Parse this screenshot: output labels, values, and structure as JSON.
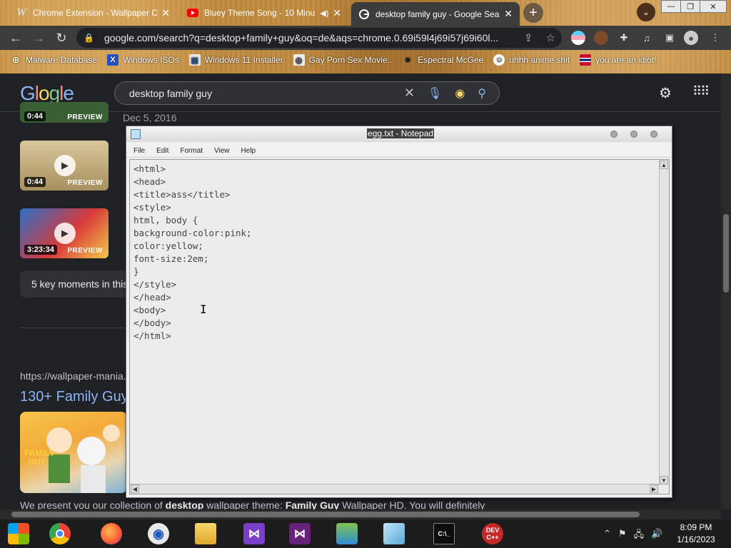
{
  "browser": {
    "tabs": [
      {
        "label": "Chrome Extension - Wallpaper Cr",
        "icon": "wallpaper-favicon",
        "active": false
      },
      {
        "label": "Bluey Theme Song - 10 Minut",
        "icon": "youtube-favicon",
        "active": false
      },
      {
        "label": "desktop family guy - Google Sear",
        "icon": "google-favicon",
        "active": true
      }
    ],
    "url": "google.com/search?q=desktop+family+guy&oq=de&aqs=chrome.0.69i59l4j69i57j69i60l...",
    "bookmarks": [
      {
        "label": "Malware Database",
        "icon": "bookmark-globe-icon"
      },
      {
        "label": "Windows ISOs",
        "icon": "bookmark-x-icon"
      },
      {
        "label": "Windows 11 Installer",
        "icon": "bookmark-image-icon"
      },
      {
        "label": "Gay Porn Sex Movie..",
        "icon": "bookmark-site-icon"
      },
      {
        "label": "Espectral McGee",
        "icon": "bookmark-avatar-icon"
      },
      {
        "label": "uhhh anime shit",
        "icon": "bookmark-anime-icon"
      },
      {
        "label": "you are an idiot!",
        "icon": "bookmark-flag-icon"
      }
    ]
  },
  "google": {
    "logo": "Google",
    "query": "desktop family guy",
    "date": "Dec 5, 2016",
    "videos": [
      {
        "duration": "0:44",
        "preview": "PREVIEW"
      },
      {
        "duration": "0:44",
        "preview": "PREVIEW"
      },
      {
        "duration": "3:23:34",
        "preview": "PREVIEW"
      }
    ],
    "key_moments": "5 key moments in this",
    "result_url": "https://wallpaper-mania.",
    "result_title": "130+ Family Guy",
    "snippet": {
      "part1": "We present you our collection of ",
      "bold1": "desktop",
      "part2": " wallpaper theme: ",
      "bold2": "Family Guy",
      "part3": " Wallpaper HD. You will definitely"
    }
  },
  "notepad": {
    "title": "egg.txt - Notepad",
    "menu": [
      "File",
      "Edit",
      "Format",
      "View",
      "Help"
    ],
    "content": "<html>\n<head>\n<title>ass</title>\n<style>\nhtml, body {\nbackground-color:pink;\ncolor:yellow;\nfont-size:2em;\n}\n</style>\n</head>\n<body>\n</body>\n</html>"
  },
  "taskbar": {
    "time": "8:09 PM",
    "date": "1/16/2023"
  },
  "colors": {
    "page_bg": "#202124",
    "link_blue": "#8ab4f8",
    "browser_frame": "#c08a3e"
  }
}
